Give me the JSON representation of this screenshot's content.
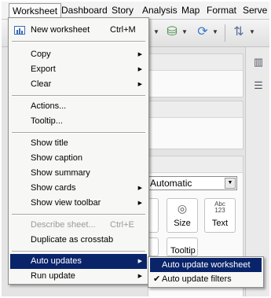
{
  "menubar": {
    "items": [
      "Worksheet",
      "Dashboard",
      "Story",
      "Analysis",
      "Map",
      "Format",
      "Serve"
    ]
  },
  "worksheet_menu": {
    "new_worksheet": {
      "label": "New worksheet",
      "shortcut": "Ctrl+M"
    },
    "copy": "Copy",
    "export": "Export",
    "clear": "Clear",
    "actions": "Actions...",
    "tooltip": "Tooltip...",
    "show_title": "Show title",
    "show_caption": "Show caption",
    "show_summary": "Show summary",
    "show_cards": "Show cards",
    "show_view_toolbar": "Show view toolbar",
    "describe_sheet": {
      "label": "Describe sheet...",
      "shortcut": "Ctrl+E"
    },
    "duplicate_as_crosstab": "Duplicate as crosstab",
    "auto_updates": "Auto updates",
    "run_update": "Run update"
  },
  "auto_updates_submenu": {
    "auto_update_worksheet": "Auto update worksheet",
    "auto_update_filters": {
      "label": "Auto update filters",
      "checked": true
    }
  },
  "marks_card": {
    "mark_type": "Automatic",
    "buttons": {
      "size": "Size",
      "text": "Text"
    },
    "text_icon": {
      "line1": "Abc",
      "line2": "123"
    },
    "tooltip_partial": "Tooltip"
  },
  "colors": {
    "highlight": "#0a246a",
    "menu_bg": "#f7f7f5"
  }
}
